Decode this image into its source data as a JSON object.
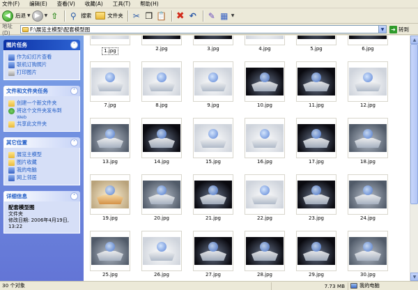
{
  "menu": [
    "文件(F)",
    "编辑(E)",
    "查看(V)",
    "收藏(A)",
    "工具(T)",
    "帮助(H)"
  ],
  "toolbar": {
    "back_label": "后退",
    "search_label": "搜索",
    "folders_label": "文件夹"
  },
  "address": {
    "label": "地址(D)",
    "value": "F:\\展览主模型\\配套模型图",
    "go_label": "转到"
  },
  "taskpane": {
    "picture_tasks": {
      "title": "图片任务",
      "items": [
        "作为幻灯片查看",
        "联机订购照片",
        "打印图片"
      ]
    },
    "file_tasks": {
      "title": "文件和文件夹任务",
      "items": [
        "创建一个新文件夹",
        "将这个文件夹发布到",
        "共享此文件夹"
      ],
      "web_sub": "Web"
    },
    "other_places": {
      "title": "其它位置",
      "items": [
        "展览主模型",
        "图片收藏",
        "我的电脑",
        "网上邻居"
      ]
    },
    "details": {
      "title": "详细信息",
      "name": "配套模型图",
      "type": "文件夹",
      "modified": "修改日期: 2006年4月19日,",
      "time": "13:22"
    }
  },
  "files": [
    {
      "name": "1.jpg",
      "tone": "light",
      "selected": true
    },
    {
      "name": "2.jpg",
      "tone": "dark"
    },
    {
      "name": "3.jpg",
      "tone": "dark"
    },
    {
      "name": "4.jpg",
      "tone": "light"
    },
    {
      "name": "5.jpg",
      "tone": "dark"
    },
    {
      "name": "6.jpg",
      "tone": "dark"
    },
    {
      "name": "7.jpg",
      "tone": "light"
    },
    {
      "name": "8.jpg",
      "tone": "light"
    },
    {
      "name": "9.jpg",
      "tone": "light"
    },
    {
      "name": "10.jpg",
      "tone": "dark"
    },
    {
      "name": "11.jpg",
      "tone": "dark"
    },
    {
      "name": "12.jpg",
      "tone": "light"
    },
    {
      "name": "13.jpg",
      "tone": "mid"
    },
    {
      "name": "14.jpg",
      "tone": "dark"
    },
    {
      "name": "15.jpg",
      "tone": "light"
    },
    {
      "name": "16.jpg",
      "tone": "light"
    },
    {
      "name": "17.jpg",
      "tone": "dark"
    },
    {
      "name": "18.jpg",
      "tone": "mid"
    },
    {
      "name": "19.jpg",
      "tone": "warm"
    },
    {
      "name": "20.jpg",
      "tone": "mid"
    },
    {
      "name": "21.jpg",
      "tone": "dark"
    },
    {
      "name": "22.jpg",
      "tone": "light"
    },
    {
      "name": "23.jpg",
      "tone": "dark"
    },
    {
      "name": "24.jpg",
      "tone": "mid"
    },
    {
      "name": "25.jpg",
      "tone": "mid"
    },
    {
      "name": "26.jpg",
      "tone": "light"
    },
    {
      "name": "27.jpg",
      "tone": "dark"
    },
    {
      "name": "28.jpg",
      "tone": "dark"
    },
    {
      "name": "29.jpg",
      "tone": "dark"
    },
    {
      "name": "30.jpg",
      "tone": "mid"
    }
  ],
  "status": {
    "count": "30 个对象",
    "size": "7.73 MB",
    "location": "我的电脑"
  }
}
